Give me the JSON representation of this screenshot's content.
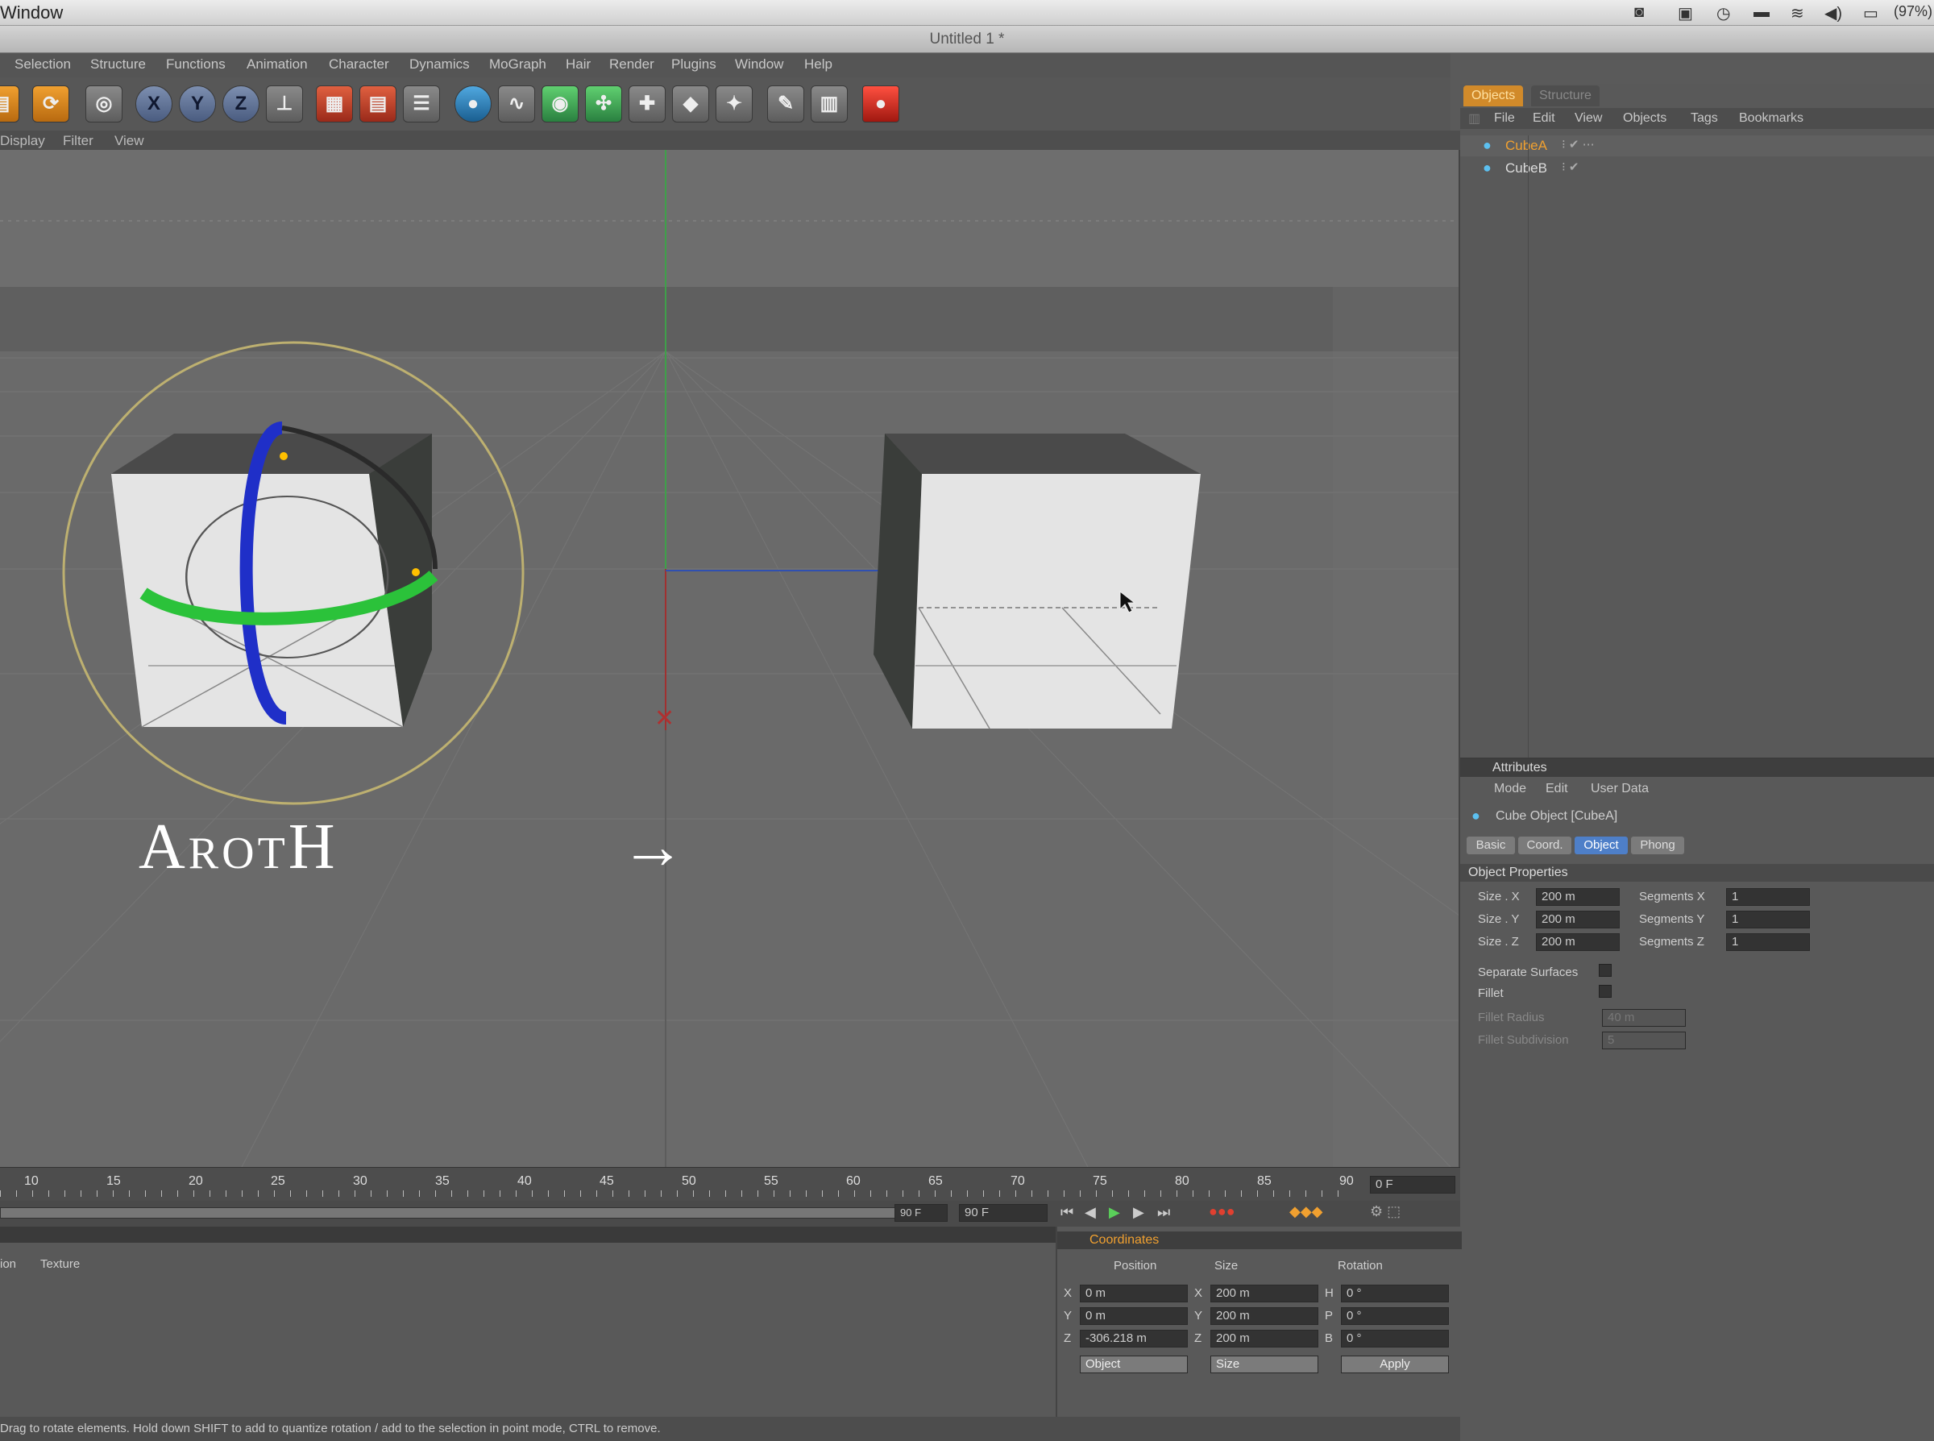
{
  "os_menubar": {
    "app_menu": "Window",
    "battery": "(97%)"
  },
  "window": {
    "title": "Untitled 1 *"
  },
  "menu": [
    "Selection",
    "Structure",
    "Functions",
    "Animation",
    "Character",
    "Dynamics",
    "MoGraph",
    "Hair",
    "Render",
    "Plugins",
    "Window",
    "Help"
  ],
  "viewport_menu": [
    "Display",
    "Filter",
    "View"
  ],
  "viewport": {
    "overlay_text": "ArotH",
    "arrow": "→"
  },
  "object_manager": {
    "tabs": [
      "Objects",
      "Structure"
    ],
    "menu": [
      "File",
      "Edit",
      "View",
      "Objects",
      "Tags",
      "Bookmarks"
    ],
    "objects": [
      {
        "name": "CubeA",
        "selected": true
      },
      {
        "name": "CubeB",
        "selected": false
      }
    ]
  },
  "attributes": {
    "title": "Attributes",
    "menu": [
      "Mode",
      "Edit",
      "User Data"
    ],
    "object_title": "Cube Object [CubeA]",
    "tabs": [
      "Basic",
      "Coord.",
      "Object",
      "Phong"
    ],
    "active_tab": "Object",
    "section": "Object Properties",
    "size_x_label": "Size . X",
    "size_x": "200 m",
    "size_y_label": "Size . Y",
    "size_y": "200 m",
    "size_z_label": "Size . Z",
    "size_z": "200 m",
    "seg_x_label": "Segments X",
    "seg_x": "1",
    "seg_y_label": "Segments Y",
    "seg_y": "1",
    "seg_z_label": "Segments Z",
    "seg_z": "1",
    "separate_surfaces": "Separate Surfaces",
    "fillet": "Fillet",
    "fillet_radius_label": "Fillet Radius",
    "fillet_radius": "40 m",
    "fillet_subdivision_label": "Fillet Subdivision",
    "fillet_subdivision": "5"
  },
  "timeline": {
    "ticks": [
      "10",
      "15",
      "20",
      "25",
      "30",
      "35",
      "40",
      "45",
      "50",
      "55",
      "60",
      "65",
      "70",
      "75",
      "80",
      "85",
      "90"
    ],
    "current_frame": "0 F",
    "end_frame": "90 F",
    "max_frame": "90 F"
  },
  "material_manager": {
    "menu": [
      "ion",
      "Texture"
    ]
  },
  "coordinates": {
    "title": "Coordinates",
    "col_position": "Position",
    "col_size": "Size",
    "col_rotation": "Rotation",
    "pos_x_label": "X",
    "pos_x": "0 m",
    "pos_y_label": "Y",
    "pos_y": "0 m",
    "pos_z_label": "Z",
    "pos_z": "-306.218 m",
    "size_x_label": "X",
    "size_x": "200 m",
    "size_y_label": "Y",
    "size_y": "200 m",
    "size_z_label": "Z",
    "size_z": "200 m",
    "rot_h_label": "H",
    "rot_h": "0 °",
    "rot_p_label": "P",
    "rot_p": "0 °",
    "rot_b_label": "B",
    "rot_b": "0 °",
    "mode_select": "Object",
    "size_select": "Size",
    "apply": "Apply"
  },
  "status_bar": "Drag to rotate elements. Hold down SHIFT to add to quantize rotation / add to the selection in point mode, CTRL to remove.",
  "colors": {
    "accent_orange": "#f0a030",
    "active_tab_blue": "#4e7fc8"
  }
}
